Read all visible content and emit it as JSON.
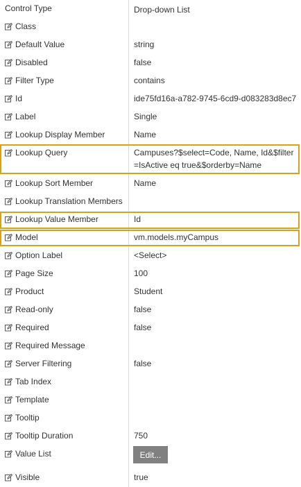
{
  "header": {
    "label": "Control Type",
    "value": "Drop-down List"
  },
  "properties": [
    {
      "label": "Class",
      "value": ""
    },
    {
      "label": "Default Value",
      "value": "string"
    },
    {
      "label": "Disabled",
      "value": "false"
    },
    {
      "label": "Filter Type",
      "value": "contains"
    },
    {
      "label": "Id",
      "value": "ide75fd16a-a782-9745-6cd9-d083283d8ec7"
    },
    {
      "label": "Label",
      "value": "Single"
    },
    {
      "label": "Lookup Display Member",
      "value": "Name"
    },
    {
      "label": "Lookup Query",
      "value": "Campuses?$select=Code, Name, Id&$filter=IsActive eq  true&$orderby=Name"
    },
    {
      "label": "Lookup Sort Member",
      "value": "Name"
    },
    {
      "label": "Lookup Translation Members",
      "value": ""
    },
    {
      "label": "Lookup Value Member",
      "value": "Id"
    },
    {
      "label": "Model",
      "value": "vm.models.myCampus"
    },
    {
      "label": "Option Label",
      "value": "<Select>"
    },
    {
      "label": "Page Size",
      "value": "100"
    },
    {
      "label": "Product",
      "value": "Student"
    },
    {
      "label": "Read-only",
      "value": "false"
    },
    {
      "label": "Required",
      "value": "false"
    },
    {
      "label": "Required Message",
      "value": ""
    },
    {
      "label": "Server Filtering",
      "value": "false"
    },
    {
      "label": "Tab Index",
      "value": ""
    },
    {
      "label": "Template",
      "value": ""
    },
    {
      "label": "Tooltip",
      "value": ""
    },
    {
      "label": "Tooltip Duration",
      "value": "750"
    },
    {
      "label": "Value List",
      "value": "",
      "button_label": "Edit..."
    },
    {
      "label": "Visible",
      "value": "true"
    }
  ],
  "icon": "edit-icon",
  "colors": {
    "highlight": "#d4a21b",
    "button_bg": "#808080",
    "divider": "#d9d9d9",
    "text": "#333333"
  }
}
